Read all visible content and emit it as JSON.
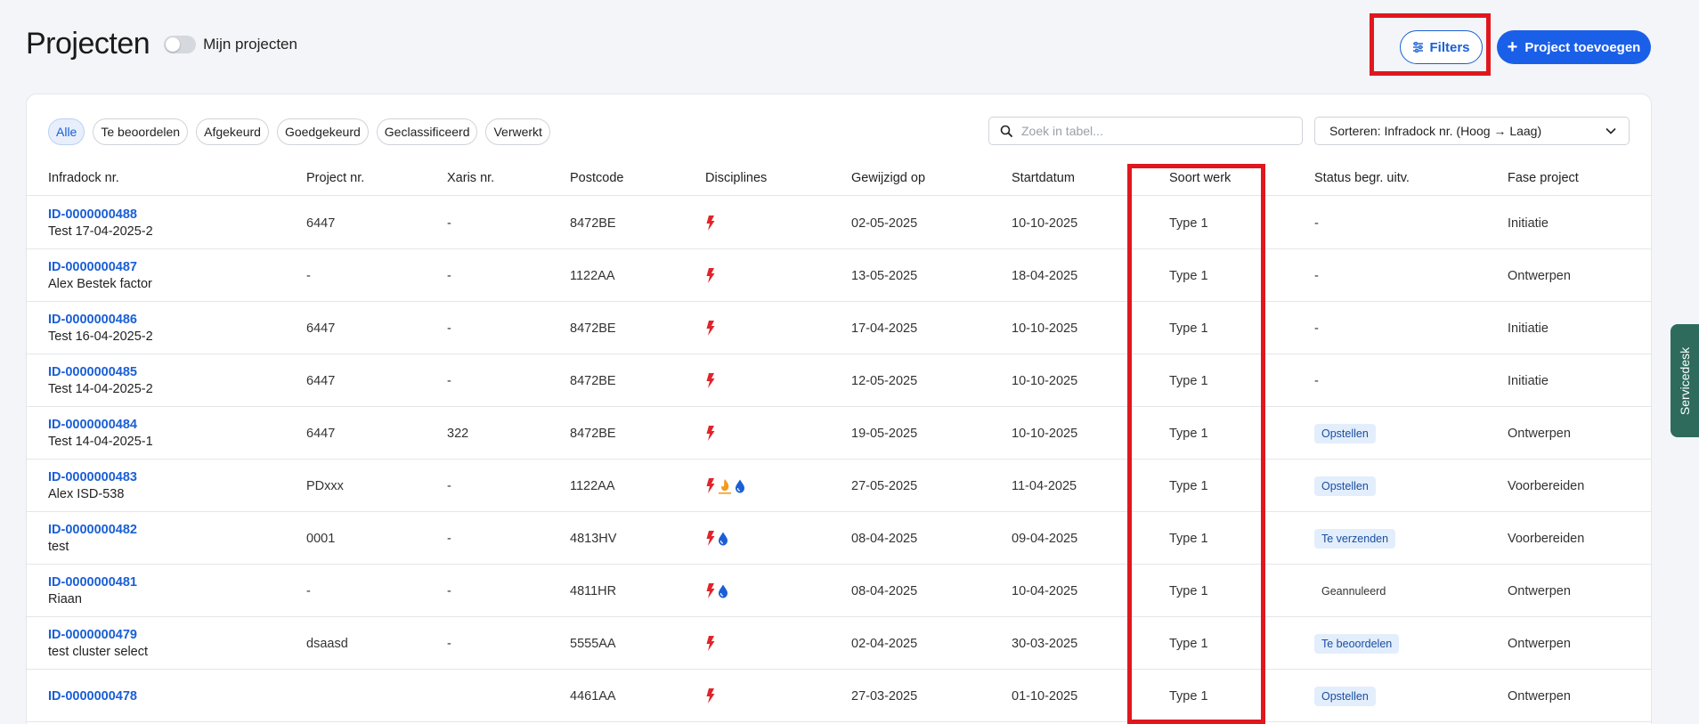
{
  "header": {
    "title": "Projecten",
    "toggle_label": "Mijn projecten",
    "filters_label": "Filters",
    "add_label": "Project toevoegen"
  },
  "chips": [
    "Alle",
    "Te beoordelen",
    "Afgekeurd",
    "Goedgekeurd",
    "Geclassificeerd",
    "Verwerkt"
  ],
  "search": {
    "placeholder": "Zoek in tabel..."
  },
  "sort": {
    "label": "Sorteren: Infradock nr. (Hoog → Laag)"
  },
  "columns": [
    "Infradock nr.",
    "Project nr.",
    "Xaris nr.",
    "Postcode",
    "Disciplines",
    "Gewijzigd op",
    "Startdatum",
    "Soort werk",
    "Status begr. uitv.",
    "Fase project"
  ],
  "rows": [
    {
      "id": "ID-0000000488",
      "name": "Test 17-04-2025-2",
      "project": "6447",
      "xaris": "-",
      "postcode": "8472BE",
      "disciplines": [
        "electric"
      ],
      "modified": "02-05-2025",
      "start": "10-10-2025",
      "soort": "Type 1",
      "status": "-",
      "status_type": "text",
      "fase": "Initiatie"
    },
    {
      "id": "ID-0000000487",
      "name": "Alex Bestek factor",
      "project": "-",
      "xaris": "-",
      "postcode": "1122AA",
      "disciplines": [
        "electric"
      ],
      "modified": "13-05-2025",
      "start": "18-04-2025",
      "soort": "Type 1",
      "status": "-",
      "status_type": "text",
      "fase": "Ontwerpen"
    },
    {
      "id": "ID-0000000486",
      "name": "Test 16-04-2025-2",
      "project": "6447",
      "xaris": "-",
      "postcode": "8472BE",
      "disciplines": [
        "electric"
      ],
      "modified": "17-04-2025",
      "start": "10-10-2025",
      "soort": "Type 1",
      "status": "-",
      "status_type": "text",
      "fase": "Initiatie"
    },
    {
      "id": "ID-0000000485",
      "name": "Test 14-04-2025-2",
      "project": "6447",
      "xaris": "-",
      "postcode": "8472BE",
      "disciplines": [
        "electric"
      ],
      "modified": "12-05-2025",
      "start": "10-10-2025",
      "soort": "Type 1",
      "status": "-",
      "status_type": "text",
      "fase": "Initiatie"
    },
    {
      "id": "ID-0000000484",
      "name": "Test 14-04-2025-1",
      "project": "6447",
      "xaris": "322",
      "postcode": "8472BE",
      "disciplines": [
        "electric"
      ],
      "modified": "19-05-2025",
      "start": "10-10-2025",
      "soort": "Type 1",
      "status": "Opstellen",
      "status_type": "badge",
      "fase": "Ontwerpen"
    },
    {
      "id": "ID-0000000483",
      "name": "Alex ISD-538",
      "project": "PDxxx",
      "xaris": "-",
      "postcode": "1122AA",
      "disciplines": [
        "electric",
        "gas",
        "water"
      ],
      "modified": "27-05-2025",
      "start": "11-04-2025",
      "soort": "Type 1",
      "status": "Opstellen",
      "status_type": "badge",
      "fase": "Voorbereiden"
    },
    {
      "id": "ID-0000000482",
      "name": "test",
      "project": "0001",
      "xaris": "-",
      "postcode": "4813HV",
      "disciplines": [
        "electric",
        "water"
      ],
      "modified": "08-04-2025",
      "start": "09-04-2025",
      "soort": "Type 1",
      "status": "Te verzenden",
      "status_type": "badge",
      "fase": "Voorbereiden"
    },
    {
      "id": "ID-0000000481",
      "name": "Riaan",
      "project": "-",
      "xaris": "-",
      "postcode": "4811HR",
      "disciplines": [
        "electric",
        "water"
      ],
      "modified": "08-04-2025",
      "start": "10-04-2025",
      "soort": "Type 1",
      "status": "Geannuleerd",
      "status_type": "plain",
      "fase": "Ontwerpen"
    },
    {
      "id": "ID-0000000479",
      "name": "test cluster select",
      "project": "dsaasd",
      "xaris": "-",
      "postcode": "5555AA",
      "disciplines": [
        "electric"
      ],
      "modified": "02-04-2025",
      "start": "30-03-2025",
      "soort": "Type 1",
      "status": "Te beoordelen",
      "status_type": "badge",
      "fase": "Ontwerpen"
    },
    {
      "id": "ID-0000000478",
      "name": "",
      "project": "",
      "xaris": "",
      "postcode": "4461AA",
      "disciplines": [
        "electric"
      ],
      "modified": "27-03-2025",
      "start": "01-10-2025",
      "soort": "Type 1",
      "status": "Opstellen",
      "status_type": "badge",
      "fase": "Ontwerpen"
    }
  ],
  "servicedesk": "Servicedesk",
  "colors": {
    "accent": "#1a5fe8",
    "electric": "#e0242b",
    "gas": "#f29b1d",
    "water": "#1a5fd6",
    "highlight": "#e0181e"
  }
}
